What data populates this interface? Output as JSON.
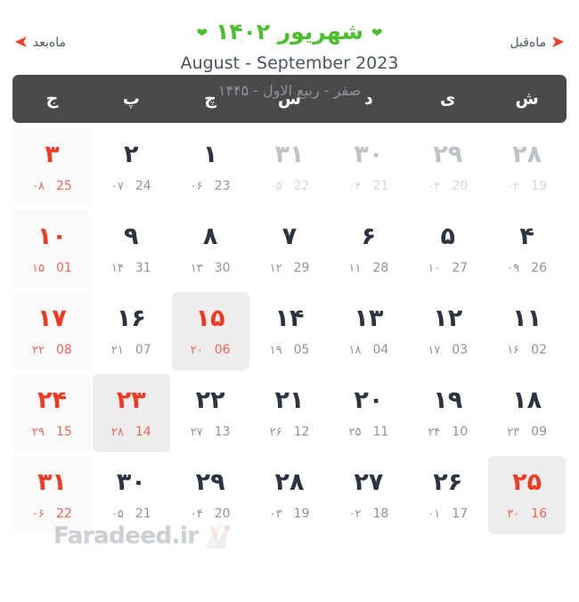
{
  "nav": {
    "prev_label": "ماه‌قبل",
    "prev_icon": "arrow-right-icon",
    "prev_arrow": "➜",
    "next_label": "ماه‌بعد",
    "next_icon": "arrow-left-icon",
    "next_arrow": "➜"
  },
  "title": {
    "persian_month_year": "شهریور ۱۴۰۲",
    "chevron": "❤",
    "gregorian_range": "August - September 2023",
    "hijri_range": "صفر - ربیع الاول - ۱۴۴۵"
  },
  "colors": {
    "title_green": "#4bbf2e",
    "arrow_red": "#f4402a",
    "header_bar": "#4a4a4a",
    "holiday_red": "#f03a23",
    "muted_gray": "#bfc3c9",
    "today_bg": "#ededed",
    "friday_bg": "#fafafa"
  },
  "weekdays": [
    {
      "label": "ش"
    },
    {
      "label": "ی"
    },
    {
      "label": "د"
    },
    {
      "label": "س"
    },
    {
      "label": "چ"
    },
    {
      "label": "پ"
    },
    {
      "label": "ج"
    }
  ],
  "weeks": [
    [
      {
        "day": "۲۸",
        "hijri": "۰۲",
        "greg": "19",
        "state": "muted"
      },
      {
        "day": "۲۹",
        "hijri": "۰۳",
        "greg": "20",
        "state": "muted"
      },
      {
        "day": "۳۰",
        "hijri": "۰۴",
        "greg": "21",
        "state": "muted"
      },
      {
        "day": "۳۱",
        "hijri": "۰۵",
        "greg": "22",
        "state": "muted"
      },
      {
        "day": "۱",
        "hijri": "۰۶",
        "greg": "23",
        "state": "normal"
      },
      {
        "day": "۲",
        "hijri": "۰۷",
        "greg": "24",
        "state": "normal"
      },
      {
        "day": "۳",
        "hijri": "۰۸",
        "greg": "25",
        "state": "friday"
      }
    ],
    [
      {
        "day": "۴",
        "hijri": "۰۹",
        "greg": "26",
        "state": "normal"
      },
      {
        "day": "۵",
        "hijri": "۱۰",
        "greg": "27",
        "state": "normal"
      },
      {
        "day": "۶",
        "hijri": "۱۱",
        "greg": "28",
        "state": "normal"
      },
      {
        "day": "۷",
        "hijri": "۱۲",
        "greg": "29",
        "state": "normal"
      },
      {
        "day": "۸",
        "hijri": "۱۳",
        "greg": "30",
        "state": "normal"
      },
      {
        "day": "۹",
        "hijri": "۱۴",
        "greg": "31",
        "state": "normal"
      },
      {
        "day": "۱۰",
        "hijri": "۱۵",
        "greg": "01",
        "state": "friday"
      }
    ],
    [
      {
        "day": "۱۱",
        "hijri": "۱۶",
        "greg": "02",
        "state": "normal"
      },
      {
        "day": "۱۲",
        "hijri": "۱۷",
        "greg": "03",
        "state": "normal"
      },
      {
        "day": "۱۳",
        "hijri": "۱۸",
        "greg": "04",
        "state": "normal"
      },
      {
        "day": "۱۴",
        "hijri": "۱۹",
        "greg": "05",
        "state": "normal"
      },
      {
        "day": "۱۵",
        "hijri": "۲۰",
        "greg": "06",
        "state": "today"
      },
      {
        "day": "۱۶",
        "hijri": "۲۱",
        "greg": "07",
        "state": "normal"
      },
      {
        "day": "۱۷",
        "hijri": "۲۲",
        "greg": "08",
        "state": "friday"
      }
    ],
    [
      {
        "day": "۱۸",
        "hijri": "۲۳",
        "greg": "09",
        "state": "normal"
      },
      {
        "day": "۱۹",
        "hijri": "۲۴",
        "greg": "10",
        "state": "normal"
      },
      {
        "day": "۲۰",
        "hijri": "۲۵",
        "greg": "11",
        "state": "normal"
      },
      {
        "day": "۲۱",
        "hijri": "۲۶",
        "greg": "12",
        "state": "normal"
      },
      {
        "day": "۲۲",
        "hijri": "۲۷",
        "greg": "13",
        "state": "normal"
      },
      {
        "day": "۲۳",
        "hijri": "۲۸",
        "greg": "14",
        "state": "today"
      },
      {
        "day": "۲۴",
        "hijri": "۲۹",
        "greg": "15",
        "state": "friday"
      }
    ],
    [
      {
        "day": "۲۵",
        "hijri": "۳۰",
        "greg": "16",
        "state": "today"
      },
      {
        "day": "۲۶",
        "hijri": "۰۱",
        "greg": "17",
        "state": "normal"
      },
      {
        "day": "۲۷",
        "hijri": "۰۲",
        "greg": "18",
        "state": "normal"
      },
      {
        "day": "۲۸",
        "hijri": "۰۳",
        "greg": "19",
        "state": "normal"
      },
      {
        "day": "۲۹",
        "hijri": "۰۴",
        "greg": "20",
        "state": "normal"
      },
      {
        "day": "۳۰",
        "hijri": "۰۵",
        "greg": "21",
        "state": "normal"
      },
      {
        "day": "۳۱",
        "hijri": "۰۶",
        "greg": "22",
        "state": "friday"
      }
    ]
  ],
  "watermark": {
    "text": "Faradeed.ir"
  }
}
